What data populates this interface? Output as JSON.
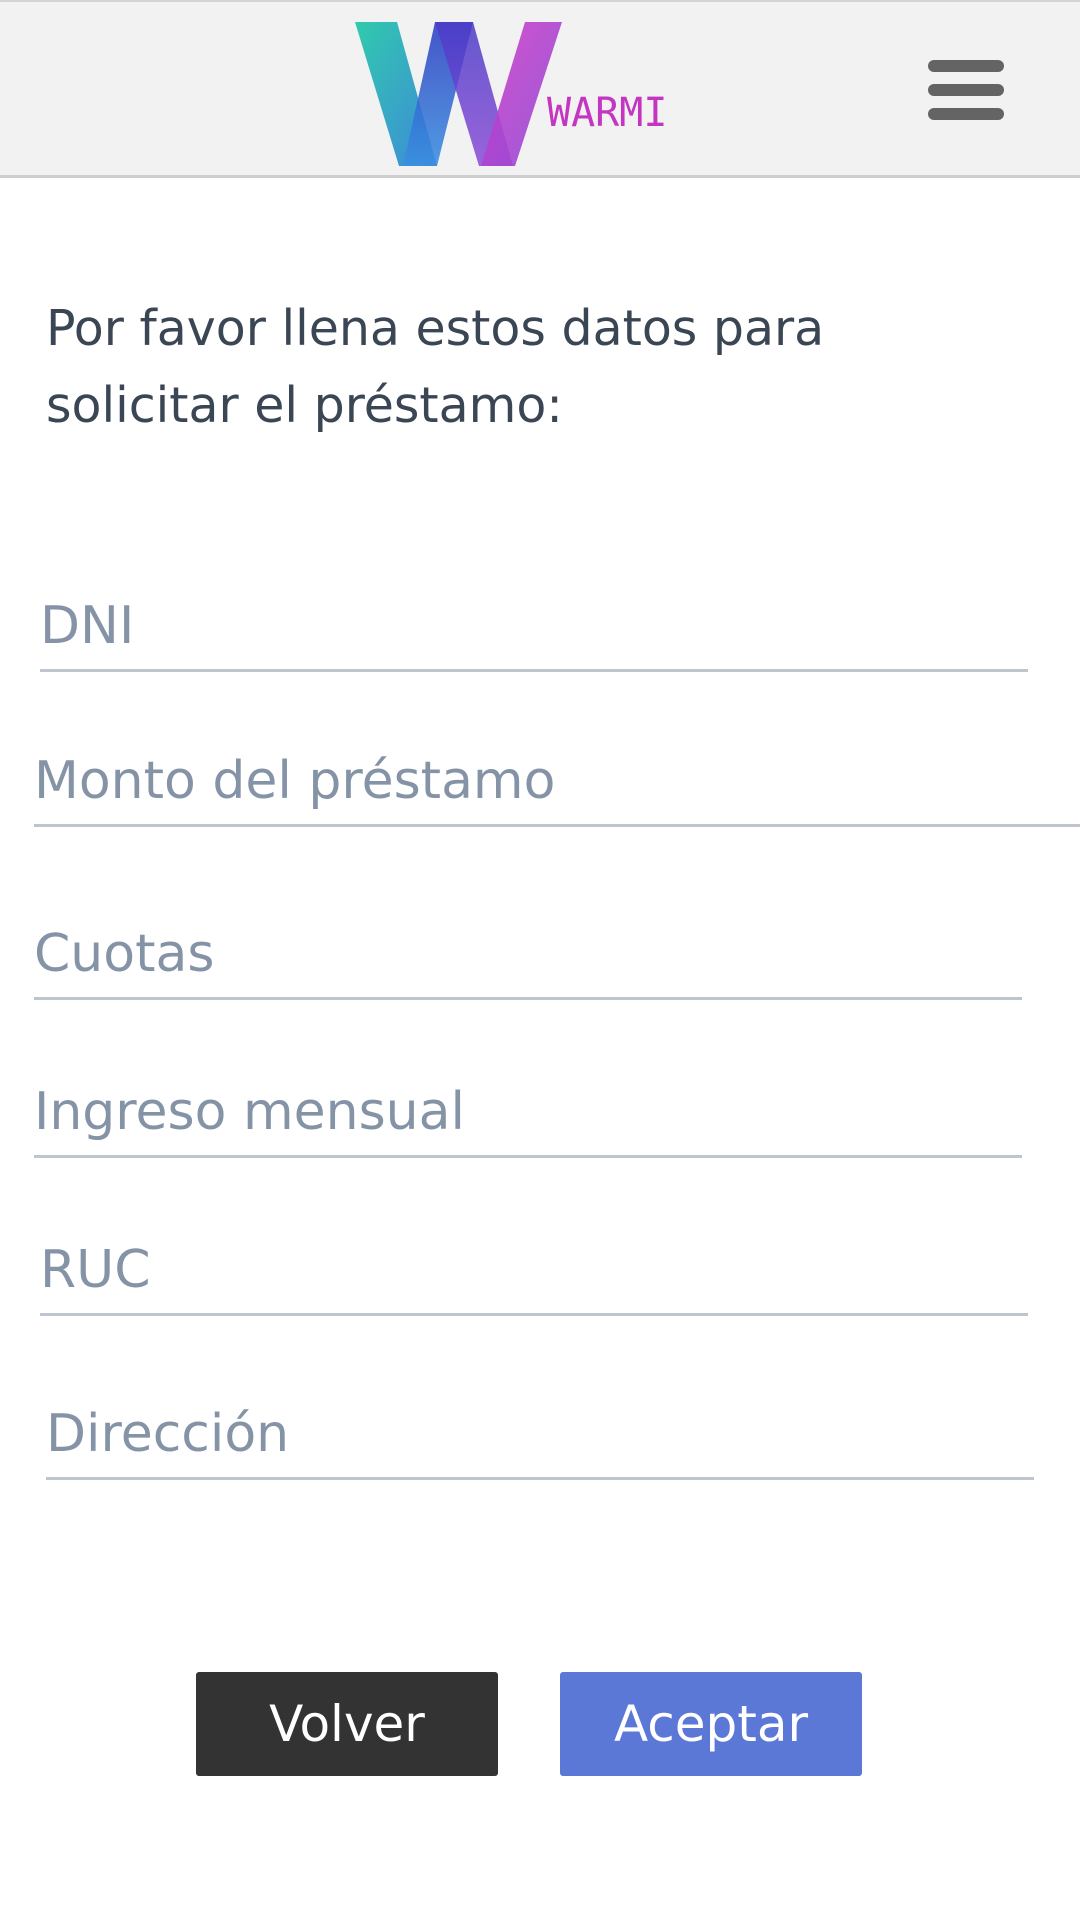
{
  "header": {
    "logo_text": "WARMI",
    "menu_icon": "hamburger-menu-icon"
  },
  "form": {
    "intro_text": "Por favor llena estos datos para solicitar el préstamo:",
    "fields": [
      {
        "placeholder": "DNI",
        "value": ""
      },
      {
        "placeholder": "Monto del préstamo",
        "value": ""
      },
      {
        "placeholder": "Cuotas",
        "value": ""
      },
      {
        "placeholder": "Ingreso mensual",
        "value": ""
      },
      {
        "placeholder": "RUC",
        "value": ""
      },
      {
        "placeholder": "Dirección",
        "value": ""
      }
    ]
  },
  "actions": {
    "back_label": "Volver",
    "accept_label": "Aceptar"
  },
  "colors": {
    "header_bg": "#f2f2f2",
    "back_button": "#333333",
    "accept_button": "#5b78d6",
    "placeholder_text": "#8593a6",
    "logo_magenta": "#c436c2"
  }
}
